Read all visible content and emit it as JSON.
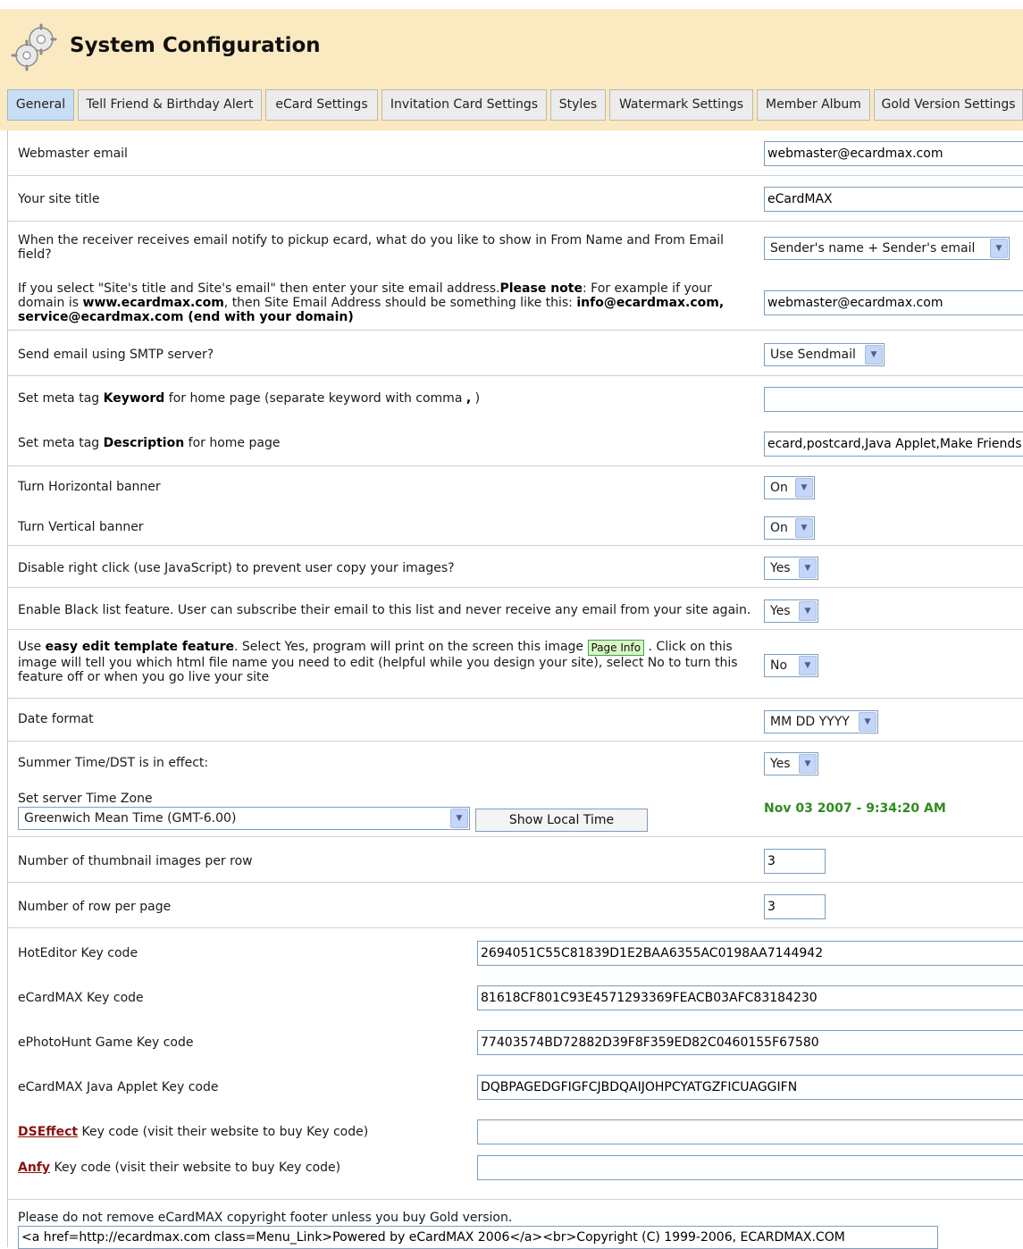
{
  "header": {
    "title": "System Configuration",
    "icon": "gears-icon"
  },
  "tabs": [
    {
      "label": "General",
      "active": true
    },
    {
      "label": "Tell Friend & Birthday Alert"
    },
    {
      "label": "eCard Settings"
    },
    {
      "label": "Invitation Card Settings"
    },
    {
      "label": "Styles"
    },
    {
      "label": "Watermark Settings"
    },
    {
      "label": "Member Album"
    },
    {
      "label": "Gold Version Settings"
    }
  ],
  "settings": {
    "webmaster_email": {
      "label": "Webmaster email",
      "value": "webmaster@ecardmax.com"
    },
    "site_title": {
      "label": "Your site title",
      "value": "eCardMAX"
    },
    "from_name": {
      "label": "When the receiver receives email notify to pickup ecard, what do you like to show in From Name and From Email field?",
      "value": "Sender's name + Sender's email"
    },
    "site_email": {
      "label_a": "If you select \"Site's title and Site's email\" then enter your site email address.",
      "label_note": "Please note",
      "label_b": ": For example if your domain is ",
      "label_domain": "www.ecardmax.com",
      "label_c": ", then Site Email Address should be something like this: ",
      "label_example": "info@ecardmax.com, service@ecardmax.com (end with your domain)",
      "value": "webmaster@ecardmax.com"
    },
    "smtp": {
      "label": "Send email using SMTP server?",
      "value": "Use Sendmail"
    },
    "meta_keyword": {
      "label_a": "Set meta tag ",
      "label_bold": "Keyword",
      "label_b": " for home page (separate keyword with comma ",
      "label_comma": ",",
      "label_c": " )",
      "value": ""
    },
    "meta_description": {
      "label_a": "Set meta tag ",
      "label_bold": "Description",
      "label_b": " for home page",
      "value": "ecard,postcard,Java Applet,Make Friends"
    },
    "horizontal_banner": {
      "label": "Turn Horizontal banner",
      "value": "On"
    },
    "vertical_banner": {
      "label": "Turn Vertical banner",
      "value": "On"
    },
    "disable_right_click": {
      "label": "Disable right click (use JavaScript) to prevent user copy your images?",
      "value": "Yes"
    },
    "black_list": {
      "label": "Enable Black list feature. User can subscribe their email to this list and never receive any email from your site again.",
      "value": "Yes"
    },
    "easy_edit": {
      "label_a": "Use ",
      "label_bold": "easy edit template feature",
      "label_b": ". Select Yes, program will print on the screen this image ",
      "badge": "Page Info",
      "label_c": " . Click on this image will tell you which html file name you need to edit (helpful while you design your site), select No to turn this feature off or when you go live your site",
      "value": "No"
    },
    "date_format": {
      "label": "Date format",
      "value": "MM DD YYYY"
    },
    "dst": {
      "label": "Summer Time/DST is in effect:",
      "value": "Yes"
    },
    "timezone": {
      "label": "Set server Time Zone",
      "value": "Greenwich Mean Time (GMT-6.00)",
      "button": "Show Local Time",
      "clock": "Nov 03 2007 - 9:34:20 AM"
    },
    "thumbs_per_row": {
      "label": "Number of thumbnail images per row",
      "value": "3"
    },
    "rows_per_page": {
      "label": "Number of row per page",
      "value": "3"
    },
    "hoteditor_key": {
      "label": "HotEditor Key code",
      "value": "2694051C55C81839D1E2BAA6355AC0198AA7144942"
    },
    "ecardmax_key": {
      "label": "eCardMAX Key code",
      "value": "81618CF801C93E4571293369FEACB03AFC83184230"
    },
    "ephotohunt_key": {
      "label": "ePhotoHunt Game Key code",
      "value": "77403574BD72882D39F8F359ED82C0460155F67580"
    },
    "java_applet_key": {
      "label": "eCardMAX Java Applet Key code",
      "value": "DQBPAGEDGFIGFCJBDQAIJOHPCYATGZFICUAGGIFN"
    },
    "dseffect_key": {
      "link": "DSEffect",
      "label": " Key code (visit their website to buy Key code)",
      "value": ""
    },
    "anfy_key": {
      "link": "Anfy",
      "label": " Key code (visit their website to buy Key code)",
      "value": ""
    },
    "footer": {
      "label": "Please do not remove eCardMAX copyright footer unless you buy Gold version.",
      "value": "<a href=http://ecardmax.com class=Menu_Link>Powered by eCardMAX 2006</a><br>Copyright (C) 1999-2006, ECARDMAX.COM"
    }
  },
  "colors": {
    "header_bg": "#fbe9c1",
    "active_tab": "#c9ddf3",
    "clock": "#2f8b1f",
    "link": "#8b1111"
  }
}
